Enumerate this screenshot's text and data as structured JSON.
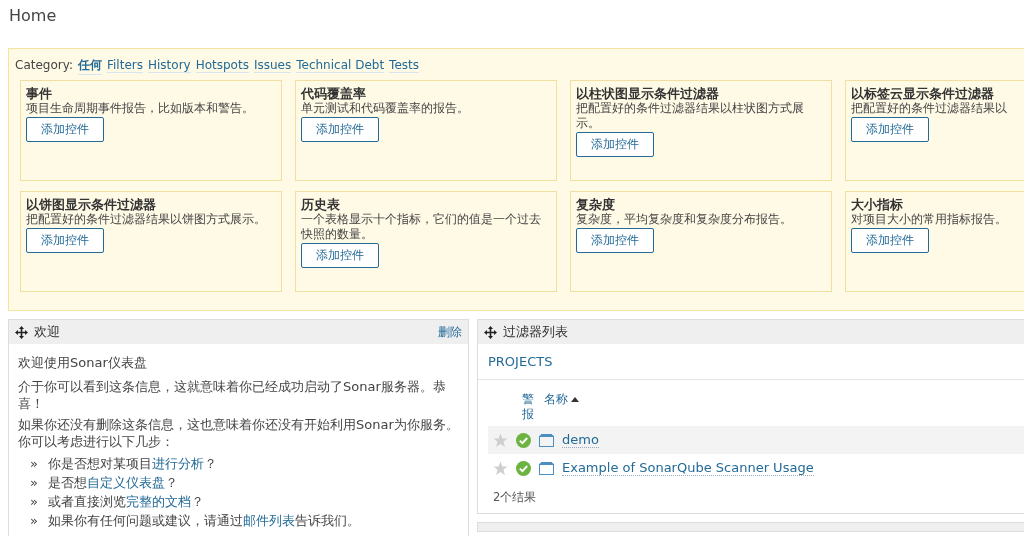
{
  "page_title": "Home",
  "category": {
    "label": "Category:",
    "options": [
      {
        "label": "任何",
        "selected": true
      },
      {
        "label": "Filters",
        "selected": false
      },
      {
        "label": "History",
        "selected": false
      },
      {
        "label": "Hotspots",
        "selected": false
      },
      {
        "label": "Issues",
        "selected": false
      },
      {
        "label": "Technical Debt",
        "selected": false
      },
      {
        "label": "Tests",
        "selected": false
      }
    ]
  },
  "widgets": [
    {
      "title": "事件",
      "description": "项目生命周期事件报告，比如版本和警告。",
      "button": "添加控件"
    },
    {
      "title": "代码覆盖率",
      "description": "单元测试和代码覆盖率的报告。",
      "button": "添加控件"
    },
    {
      "title": "以柱状图显示条件过滤器",
      "description": "把配置好的条件过滤器结果以柱状图方式展示。",
      "button": "添加控件"
    },
    {
      "title": "以标签云显示条件过滤器",
      "description": "把配置好的条件过滤器结果以",
      "button": "添加控件"
    },
    {
      "title": "以饼图显示条件过滤器",
      "description": "把配置好的条件过滤器结果以饼图方式展示。",
      "button": "添加控件"
    },
    {
      "title": "历史表",
      "description": "一个表格显示十个指标，它们的值是一个过去快照的数量。",
      "button": "添加控件"
    },
    {
      "title": "复杂度",
      "description": "复杂度，平均复杂度和复杂度分布报告。",
      "button": "添加控件"
    },
    {
      "title": "大小指标",
      "description": "对项目大小的常用指标报告。",
      "button": "添加控件"
    }
  ],
  "welcome": {
    "title": "欢迎",
    "delete": "删除",
    "heading": "欢迎使用Sonar仪表盘",
    "paragraphs": [
      "介于你可以看到这条信息，这就意味着你已经成功启动了Sonar服务器。恭喜！",
      "如果你还没有删除这条信息，这也意味着你还没有开始利用Sonar为你服务。你可以考虑进行以下几步："
    ],
    "bullet": "»",
    "steps": [
      {
        "before": "你是否想对某项目",
        "link": "进行分析",
        "after": "？"
      },
      {
        "before": "是否想",
        "link": "自定义仪表盘",
        "after": "？"
      },
      {
        "before": "或者直接浏览",
        "link": "完整的文档",
        "after": "？"
      },
      {
        "before": "如果你有任何问题或建议，请通过",
        "link": "邮件列表",
        "after": "告诉我们。"
      }
    ]
  },
  "filter_list": {
    "title": "过滤器列表",
    "heading": "PROJECTS",
    "columns": [
      "警报",
      "名称"
    ],
    "rows": [
      {
        "name": "demo",
        "favorite": false,
        "passed": true,
        "selected": true
      },
      {
        "name": "Example of SonarQube Scanner Usage",
        "favorite": false,
        "passed": true,
        "selected": false
      }
    ],
    "count": "2个结果"
  }
}
